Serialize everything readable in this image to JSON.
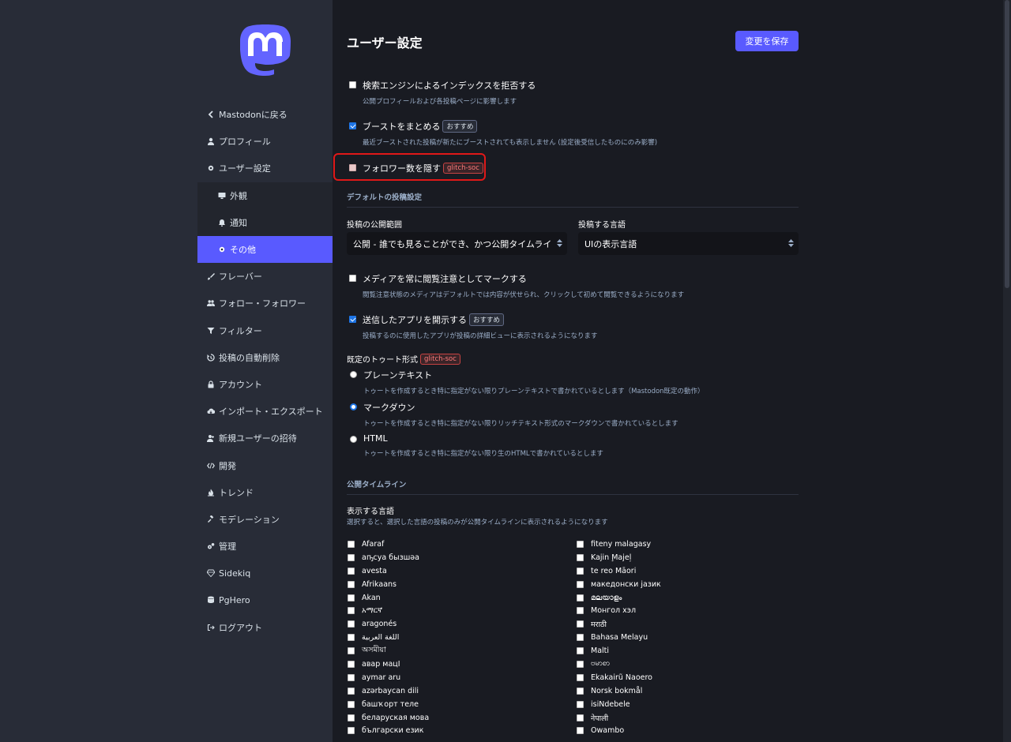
{
  "sidebar": {
    "items": [
      {
        "label": "Mastodonに戻る",
        "icon": "chevron-left-icon",
        "type": "normal"
      },
      {
        "label": "プロフィール",
        "icon": "user-icon",
        "type": "normal"
      },
      {
        "label": "ユーザー設定",
        "icon": "gear-icon",
        "type": "normal"
      },
      {
        "label": "外観",
        "icon": "desktop-icon",
        "type": "sub"
      },
      {
        "label": "通知",
        "icon": "bell-icon",
        "type": "sub"
      },
      {
        "label": "その他",
        "icon": "gear-icon",
        "type": "active"
      },
      {
        "label": "フレーバー",
        "icon": "paint-brush-icon",
        "type": "normal"
      },
      {
        "label": "フォロー・フォロワー",
        "icon": "users-icon",
        "type": "normal"
      },
      {
        "label": "フィルター",
        "icon": "filter-icon",
        "type": "normal"
      },
      {
        "label": "投稿の自動削除",
        "icon": "history-icon",
        "type": "normal"
      },
      {
        "label": "アカウント",
        "icon": "lock-icon",
        "type": "normal"
      },
      {
        "label": "インポート・エクスポート",
        "icon": "cloud-download-icon",
        "type": "normal"
      },
      {
        "label": "新規ユーザーの招待",
        "icon": "user-plus-icon",
        "type": "normal"
      },
      {
        "label": "開発",
        "icon": "code-icon",
        "type": "normal"
      },
      {
        "label": "トレンド",
        "icon": "fire-icon",
        "type": "normal"
      },
      {
        "label": "モデレーション",
        "icon": "gavel-icon",
        "type": "normal"
      },
      {
        "label": "管理",
        "icon": "cogs-icon",
        "type": "normal"
      },
      {
        "label": "Sidekiq",
        "icon": "diamond-icon",
        "type": "normal"
      },
      {
        "label": "PgHero",
        "icon": "database-icon",
        "type": "normal"
      },
      {
        "label": "ログアウト",
        "icon": "sign-out-icon",
        "type": "normal"
      }
    ]
  },
  "header": {
    "title": "ユーザー設定",
    "save_label": "変更を保存"
  },
  "settings": {
    "noindex": {
      "label": "検索エンジンによるインデックスを拒否する",
      "hint": "公開プロフィールおよび各投稿ページに影響します",
      "checked": false
    },
    "aggregate": {
      "label": "ブーストをまとめる",
      "badge": "おすすめ",
      "hint": "最近ブーストされた投稿が新たにブーストされても表示しません (設定後受信したものにのみ影響)",
      "checked": true
    },
    "hide_followers": {
      "label": "フォロワー数を隠す",
      "badge": "glitch-soc",
      "checked": false
    }
  },
  "posting_defaults": {
    "section_title": "デフォルトの投稿設定",
    "privacy_label": "投稿の公開範囲",
    "privacy_value": "公開 - 誰でも見ることができ、かつ公開タイムラインにも表示されます",
    "language_label": "投稿する言語",
    "language_value": "UIの表示言語",
    "sensitive": {
      "label": "メディアを常に閲覧注意としてマークする",
      "hint": "閲覧注意状態のメディアはデフォルトでは内容が伏せられ、クリックして初めて閲覧できるようになります",
      "checked": false
    },
    "show_app": {
      "label": "送信したアプリを開示する",
      "badge": "おすすめ",
      "hint": "投稿するのに使用したアプリが投稿の詳細ビューに表示されるようになります",
      "checked": true
    },
    "toot_format_label": "既定のトゥート形式",
    "toot_format_badge": "glitch-soc",
    "formats": [
      {
        "label": "プレーンテキスト",
        "hint": "トゥートを作成するとき特に指定がない限りプレーンテキストで書かれているとします（Mastodon既定の動作）",
        "selected": false
      },
      {
        "label": "マークダウン",
        "hint": "トゥートを作成するとき特に指定がない限りリッチテキスト形式のマークダウンで書かれているとします",
        "selected": true
      },
      {
        "label": "HTML",
        "hint": "トゥートを作成するとき特に指定がない限り生のHTMLで書かれているとします",
        "selected": false
      }
    ]
  },
  "public_timeline": {
    "section_title": "公開タイムライン",
    "languages_label": "表示する言語",
    "languages_hint": "選択すると、選択した言語の投稿のみが公開タイムラインに表示されるようになります",
    "left_languages": [
      "Afaraf",
      "аҧсуа бызшәа",
      "avesta",
      "Afrikaans",
      "Akan",
      "አማርኛ",
      "aragonés",
      "اللغة العربية",
      "অসমীয়া",
      "авар мацӀ",
      "aymar aru",
      "azərbaycan dili",
      "башҡорт теле",
      "беларуская мова",
      "български език"
    ],
    "right_languages": [
      "fiteny malagasy",
      "Kajin M̧ajeļ",
      "te reo Māori",
      "македонски јазик",
      "മലയാളം",
      "Монгол хэл",
      "मराठी",
      "Bahasa Melayu",
      "Malti",
      "ဗမာစာ",
      "Ekakairũ Naoero",
      "Norsk bokmål",
      "isiNdebele",
      "नेपाली",
      "Owambo"
    ]
  },
  "colors": {
    "accent": "#595aff",
    "badge_red": "#ff7a7a",
    "highlight": "#e01818"
  }
}
